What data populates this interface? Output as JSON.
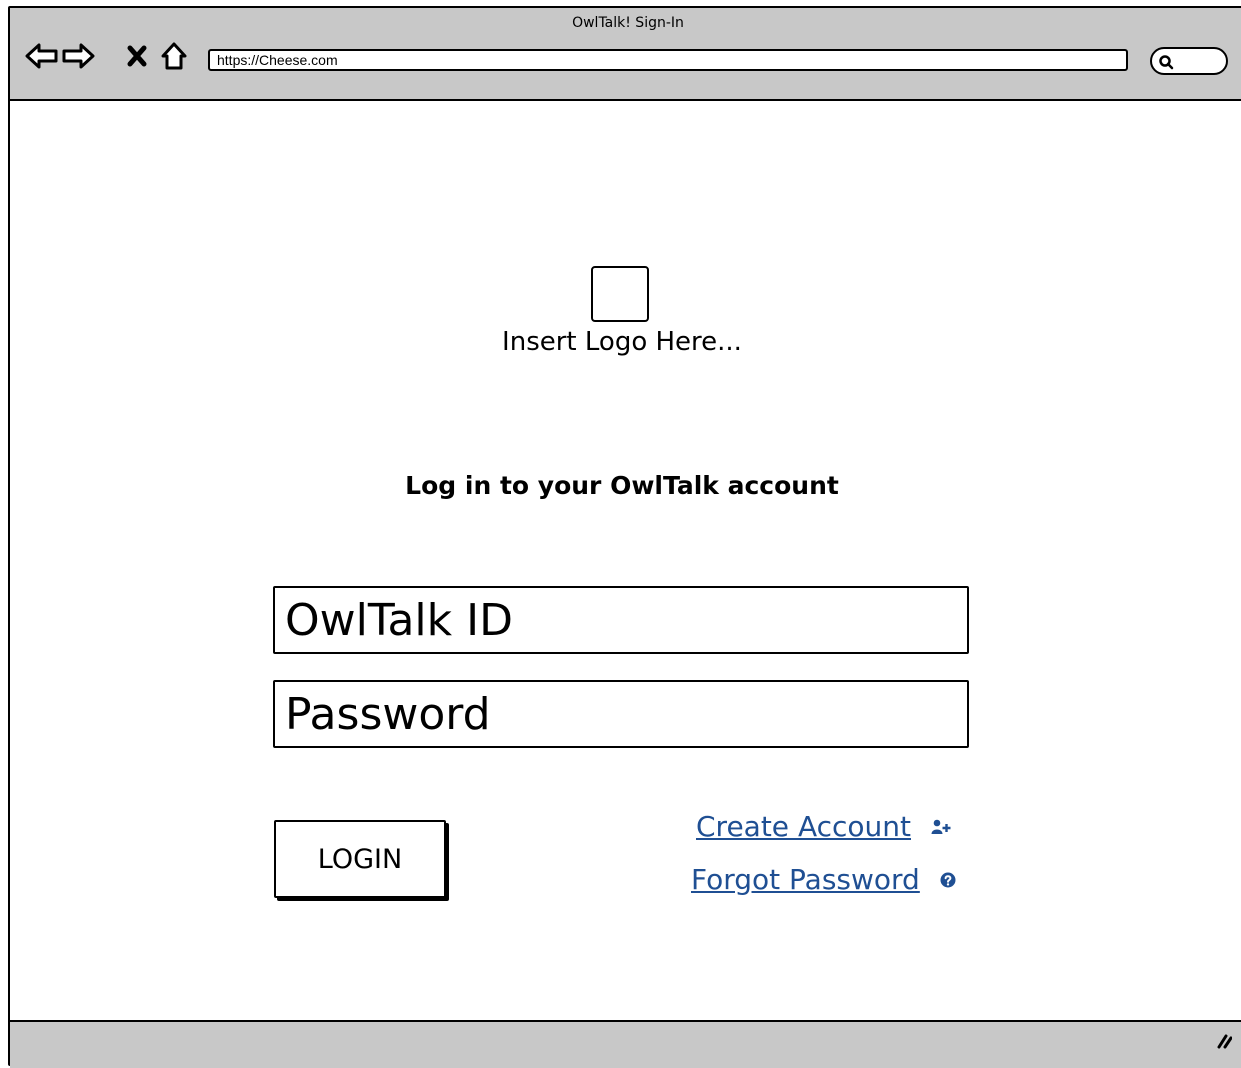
{
  "window": {
    "title": "OwlTalk! Sign-In"
  },
  "toolbar": {
    "back_icon": "back-arrow-icon",
    "forward_icon": "forward-arrow-icon",
    "stop_icon": "close-icon",
    "home_icon": "home-icon",
    "url": "https://Cheese.com",
    "search_icon": "search-icon"
  },
  "logo": {
    "caption": "Insert Logo Here..."
  },
  "login_form": {
    "heading": "Log in to your OwlTalk account",
    "id_placeholder": "OwlTalk ID",
    "password_placeholder": "Password",
    "login_label": "LOGIN",
    "create_account_label": "Create Account",
    "create_account_icon": "add-user-icon",
    "forgot_password_label": "Forgot Password",
    "forgot_password_icon": "help-icon"
  },
  "colors": {
    "chrome": "#c8c8c8",
    "link": "#1f4f93",
    "border": "#000000",
    "background": "#ffffff"
  }
}
